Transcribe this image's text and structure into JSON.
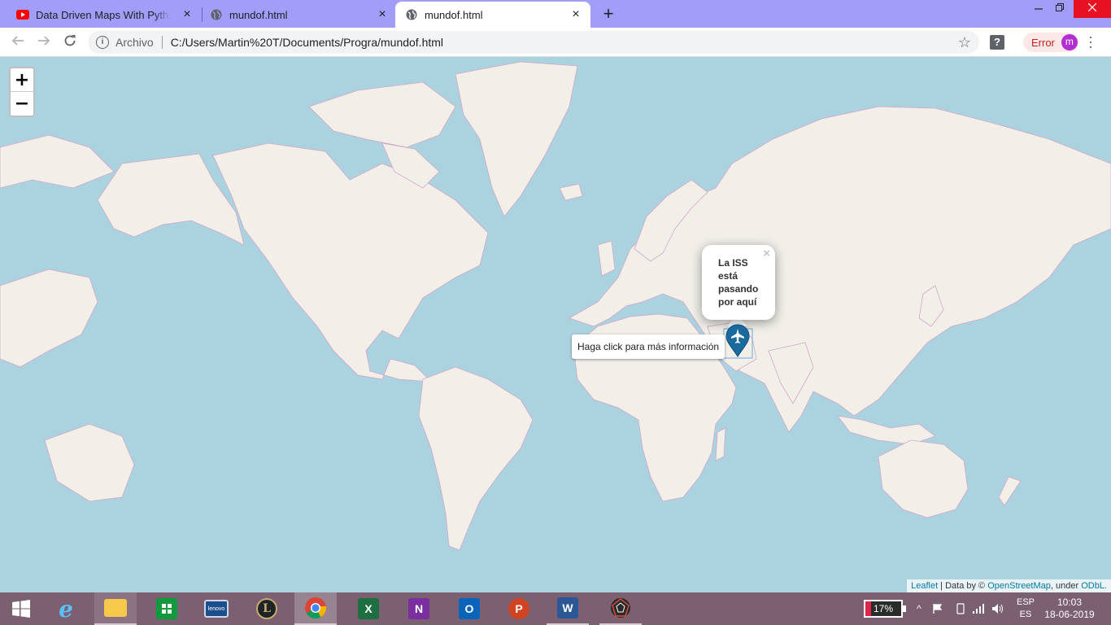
{
  "browser": {
    "tabs": [
      {
        "title": "Data Driven Maps With Python F",
        "favicon": "youtube-icon",
        "active": false
      },
      {
        "title": "mundof.html",
        "favicon": "globe-icon",
        "active": false
      },
      {
        "title": "mundof.html",
        "favicon": "globe-icon",
        "active": true
      }
    ],
    "new_tab_label": "+",
    "address": {
      "scheme_label": "Archivo",
      "url": "C:/Users/Martin%20T/Documents/Progra/mundof.html"
    },
    "help_extension_label": "?",
    "profile": {
      "status": "Error",
      "avatar_letter": "m"
    }
  },
  "map": {
    "zoom_in": "+",
    "zoom_out": "−",
    "popup": {
      "lines": [
        "La ISS",
        "está",
        "pasando",
        "por aquí"
      ],
      "close": "×"
    },
    "tooltip": "Haga click para más información",
    "marker_icon": "plane-icon",
    "marker_color": "#1a6aa0",
    "attribution": {
      "leaflet": "Leaflet",
      "data_by": " | Data by © ",
      "osm": "OpenStreetMap",
      "under": ", under ",
      "odbl": "ODbL."
    },
    "colors": {
      "water": "#aad3df",
      "land": "#f2efe9",
      "borders": "#d4a6c8"
    }
  },
  "taskbar": {
    "apps": [
      {
        "name": "windows-start",
        "label": ""
      },
      {
        "name": "internet-explorer",
        "label": "e"
      },
      {
        "name": "file-explorer",
        "label": ""
      },
      {
        "name": "microsoft-store",
        "label": ""
      },
      {
        "name": "lenovo",
        "label": "lenovo"
      },
      {
        "name": "league-of-legends",
        "label": "L"
      },
      {
        "name": "google-chrome",
        "label": ""
      },
      {
        "name": "excel",
        "label": "X"
      },
      {
        "name": "onenote",
        "label": "N"
      },
      {
        "name": "outlook",
        "label": "O"
      },
      {
        "name": "powerpoint",
        "label": "P"
      },
      {
        "name": "word",
        "label": "W"
      },
      {
        "name": "web-app",
        "label": ""
      }
    ],
    "battery_percent": 17,
    "battery_label": "17%",
    "language": {
      "top": "ESP",
      "bottom": "ES"
    },
    "time": "10:03",
    "date": "18-06-2019"
  }
}
